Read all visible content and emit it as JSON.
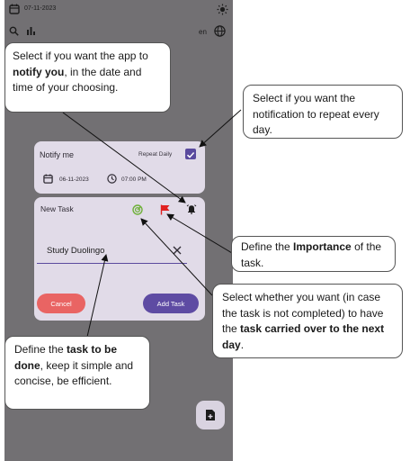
{
  "app": {
    "date": "07-11-2023",
    "language": "en"
  },
  "notify_card": {
    "label": "Notify me",
    "repeat_label": "Repeat Daily",
    "repeat_checked": true,
    "date": "06-11-2023",
    "time": "07:00 PM"
  },
  "task_card": {
    "label": "New Task",
    "task_value": "Study Duolingo",
    "cancel_label": "Cancel",
    "add_label": "Add Task"
  },
  "callouts": {
    "notify": {
      "pre": "Select if you want the app to ",
      "bold": "notify you",
      "post": ", in the date and time of your choosing."
    },
    "repeat": {
      "text": "Select if you want the notification to repeat every day."
    },
    "importance": {
      "pre": "Define the ",
      "bold": "Importance",
      "post": " of the task."
    },
    "carry": {
      "pre": "Select whether you want (in case the task is not completed) to have the ",
      "bold": "task carried over to the next day",
      "post": "."
    },
    "define": {
      "pre": "Define the ",
      "bold": "task to be done",
      "post": ", keep it simple and concise, be efficient."
    }
  },
  "colors": {
    "accent": "#5e4ba3",
    "cancel": "#e96463",
    "flag": "#e02020",
    "carry_icon": "#6fb03a",
    "card": "#e1dbe8",
    "backdrop": "#727073"
  },
  "icons": [
    "calendar-icon",
    "brightness-icon",
    "search-icon",
    "bar-chart-icon",
    "globe-icon",
    "clock-icon",
    "check-icon",
    "carry-over-icon",
    "flag-icon",
    "alarm-icon",
    "clear-icon",
    "add-note-icon"
  ]
}
